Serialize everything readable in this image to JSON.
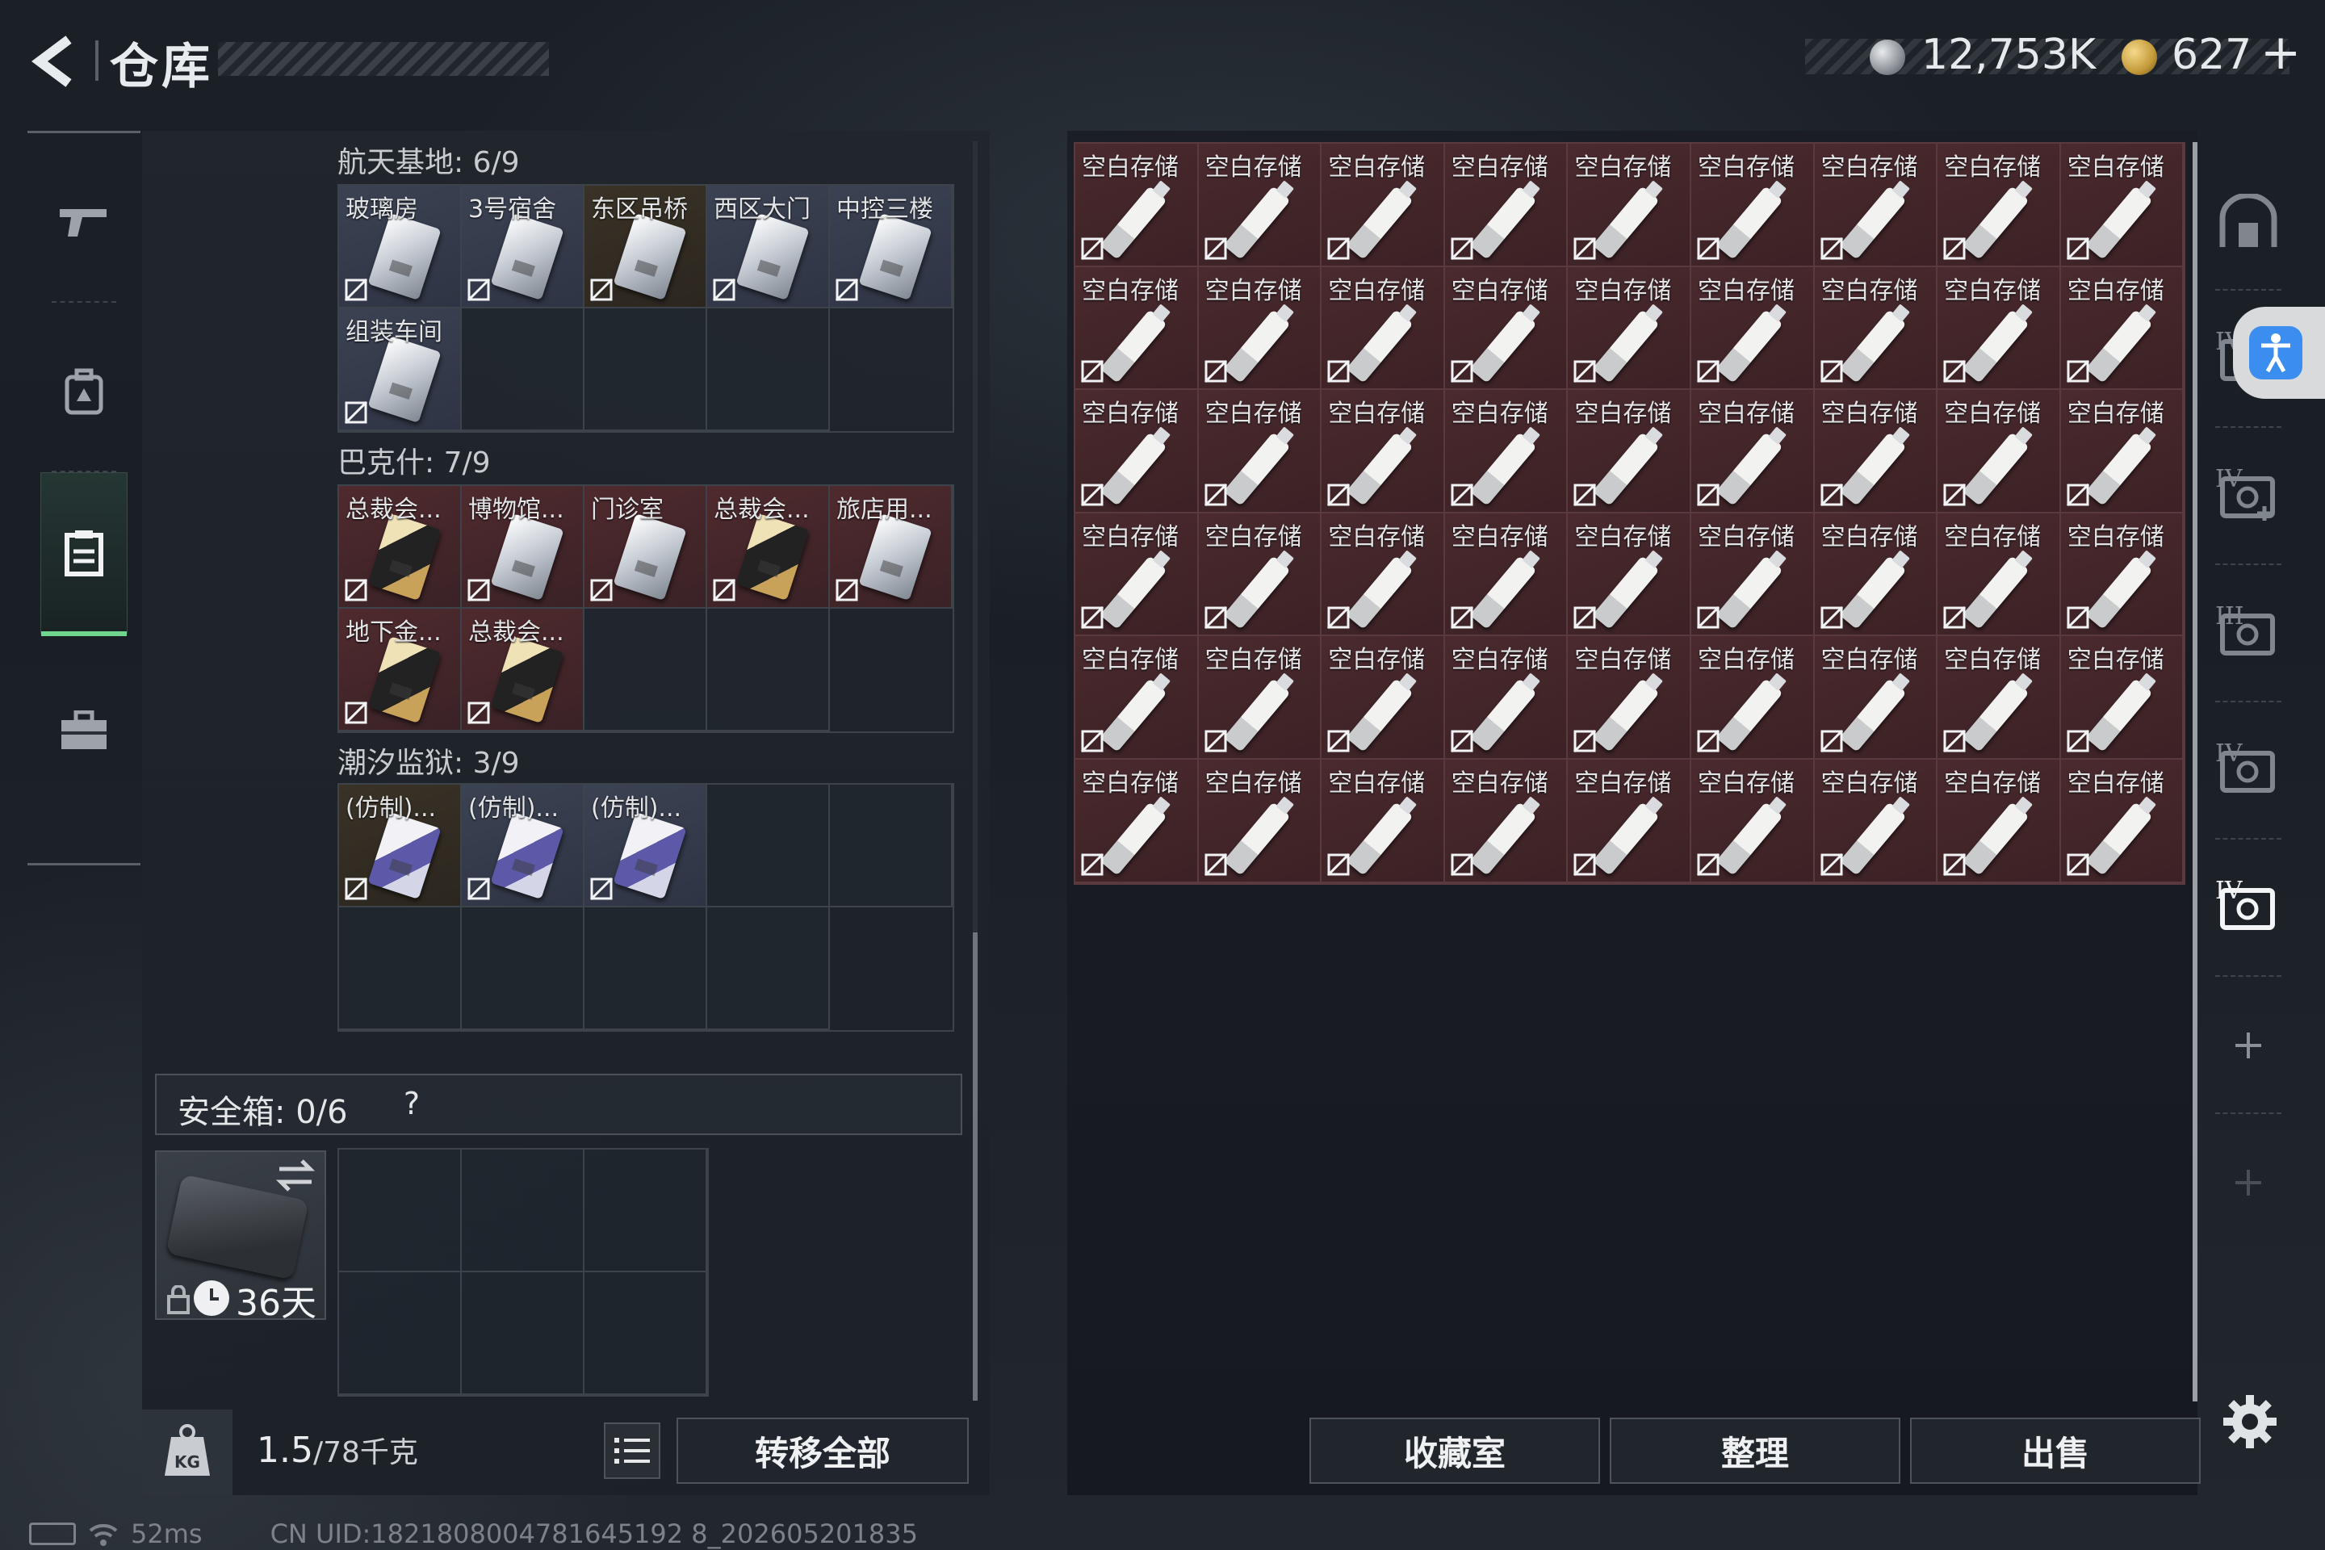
{
  "header": {
    "title": "仓库",
    "silver_amount": "12,753K",
    "gold_amount": "627",
    "gold_plus": "+"
  },
  "left_nav": {
    "items": [
      {
        "name": "weapons",
        "icon": "gun-icon"
      },
      {
        "name": "backpack",
        "icon": "backpack-icon"
      },
      {
        "name": "storage",
        "icon": "storage-icon",
        "active": true
      },
      {
        "name": "toolbox",
        "icon": "briefcase-icon"
      }
    ]
  },
  "sections": [
    {
      "title": "航天基地: 6/9",
      "items": [
        {
          "label": "玻璃房",
          "quality": "blue",
          "card": "silver"
        },
        {
          "label": "3号宿舍",
          "quality": "blue",
          "card": "silver"
        },
        {
          "label": "东区吊桥",
          "quality": "dark",
          "card": "silver"
        },
        {
          "label": "西区大门",
          "quality": "blue",
          "card": "silver"
        },
        {
          "label": "中控三楼",
          "quality": "blue",
          "card": "silver"
        },
        {
          "label": "组装车间",
          "quality": "blue",
          "card": "silver"
        },
        {
          "label": "",
          "quality": "empty"
        },
        {
          "label": "",
          "quality": "empty"
        },
        {
          "label": "",
          "quality": "empty"
        }
      ]
    },
    {
      "title": "巴克什: 7/9",
      "items": [
        {
          "label": "总裁会...",
          "quality": "red",
          "card": "gold"
        },
        {
          "label": "博物馆...",
          "quality": "red",
          "card": "silver"
        },
        {
          "label": "门诊室",
          "quality": "red",
          "card": "silver"
        },
        {
          "label": "总裁会...",
          "quality": "red",
          "card": "gold"
        },
        {
          "label": "旅店用...",
          "quality": "red",
          "card": "silver"
        },
        {
          "label": "地下金...",
          "quality": "red",
          "card": "gold"
        },
        {
          "label": "总裁会...",
          "quality": "red",
          "card": "gold"
        },
        {
          "label": "",
          "quality": "empty"
        },
        {
          "label": "",
          "quality": "empty"
        }
      ]
    },
    {
      "title": "潮汐监狱: 3/9",
      "items": [
        {
          "label": "(仿制)...",
          "quality": "dark",
          "card": "purple"
        },
        {
          "label": "(仿制)...",
          "quality": "blue",
          "card": "purple"
        },
        {
          "label": "(仿制)...",
          "quality": "blue",
          "card": "purple"
        },
        {
          "label": "",
          "quality": "empty"
        },
        {
          "label": "",
          "quality": "empty"
        },
        {
          "label": "",
          "quality": "empty"
        },
        {
          "label": "",
          "quality": "empty"
        },
        {
          "label": "",
          "quality": "empty"
        },
        {
          "label": "",
          "quality": "empty"
        }
      ]
    }
  ],
  "safebox": {
    "label": "安全箱: 0/6",
    "help": "?",
    "days": "36天"
  },
  "weight": {
    "current": "1.5",
    "capacity": "/78千克"
  },
  "buttons": {
    "transfer_all": "转移全部",
    "collection": "收藏室",
    "sort": "整理",
    "sell": "出售"
  },
  "storage": {
    "item_label": "空白存储",
    "item_count": 54
  },
  "right_tabs": [
    {
      "icon": "vault-icon",
      "roman": ""
    },
    {
      "icon": "storage-tier-icon",
      "roman": "IV"
    },
    {
      "icon": "storage-add-icon",
      "roman": "IV"
    },
    {
      "icon": "storage-tier-icon",
      "roman": "III"
    },
    {
      "icon": "storage-tier-icon",
      "roman": "IV"
    },
    {
      "icon": "storage-tier-icon",
      "roman": "IV",
      "active": true
    },
    {
      "icon": "plus-icon",
      "roman": ""
    },
    {
      "icon": "plus-icon",
      "roman": ""
    }
  ],
  "status": {
    "ping": "52ms",
    "uid": "CN UID:1821808004781645192 8_202605201835"
  },
  "colors": {
    "accent_green": "#6fd48c",
    "storage_red": "#4a2a2e",
    "access_blue": "#3b8df0"
  }
}
